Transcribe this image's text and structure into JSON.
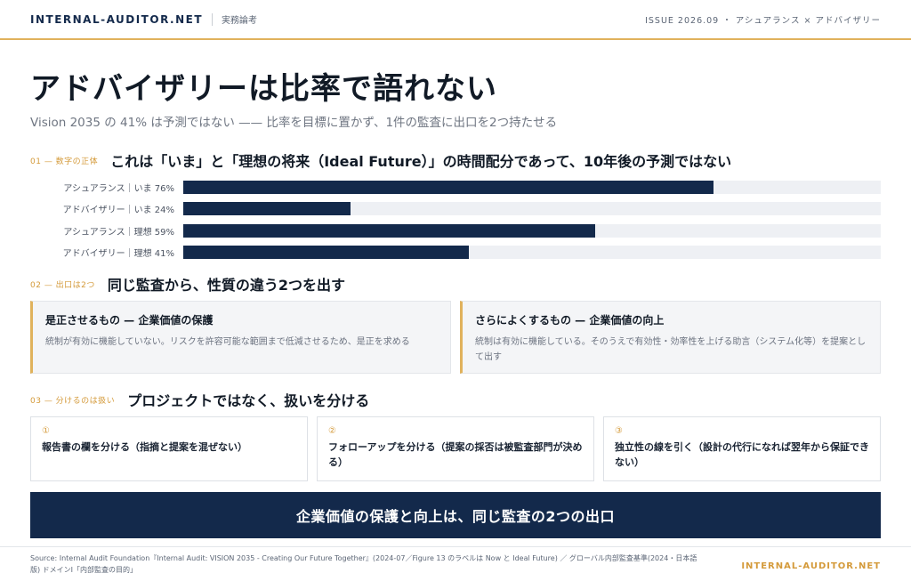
{
  "header": {
    "brand": "INTERNAL-AUDITOR.NET",
    "category": "実務論考",
    "issue": "ISSUE 2026.09 ・ アシュアランス × アドバイザリー"
  },
  "title": "アドバイザリーは比率で語れない",
  "subtitle": "Vision 2035 の 41% は予測ではない —— 比率を目標に置かず、1件の監査に出口を2つ持たせる",
  "section1": {
    "tag": "01 — 数字の正体",
    "title": "これは「いま」と「理想の将来（Ideal Future）」の時間配分であって、10年後の予測ではない"
  },
  "chart_data": {
    "type": "bar",
    "orientation": "horizontal",
    "categories": [
      "アシュアランス｜いま 76%",
      "アドバイザリー｜いま 24%",
      "アシュアランス｜理想 59%",
      "アドバイザリー｜理想 41%"
    ],
    "values": [
      76,
      24,
      59,
      41
    ],
    "xlim": [
      0,
      100
    ],
    "colors": {
      "bar": "#13294b",
      "track": "#eef0f4"
    }
  },
  "section2": {
    "tag": "02 — 出口は2つ",
    "title": "同じ監査から、性質の違う2つを出す",
    "cards": [
      {
        "title": "是正させるもの — 企業価値の保護",
        "text": "統制が有効に機能していない。リスクを許容可能な範囲まで低減させるため、是正を求める"
      },
      {
        "title": "さらによくするもの — 企業価値の向上",
        "text": "統制は有効に機能している。そのうえで有効性・効率性を上げる助言（システム化等）を提案として出す"
      }
    ]
  },
  "section3": {
    "tag": "03 — 分けるのは扱い",
    "title": "プロジェクトではなく、扱いを分ける",
    "cards": [
      {
        "num": "①",
        "text": "報告書の欄を分ける（指摘と提案を混ぜない）"
      },
      {
        "num": "②",
        "text": "フォローアップを分ける（提案の採否は被監査部門が決める）"
      },
      {
        "num": "③",
        "text": "独立性の線を引く（設計の代行になれば翌年から保証できない）"
      }
    ]
  },
  "banner": "企業価値の保護と向上は、同じ監査の2つの出口",
  "footer": {
    "source": "Source: Internal Audit Foundation『Internal Audit: VISION 2035 - Creating Our Future Together』(2024-07／Figure 13 のラベルは Now と Ideal Future) ／ グローバル内部監査基準(2024・日本語版) ドメインⅠ「内部監査の目的」",
    "brand": "INTERNAL-AUDITOR.NET"
  },
  "colors": {
    "accent": "#e0b25c",
    "navy": "#13294b",
    "tag": "#d49a3a"
  }
}
